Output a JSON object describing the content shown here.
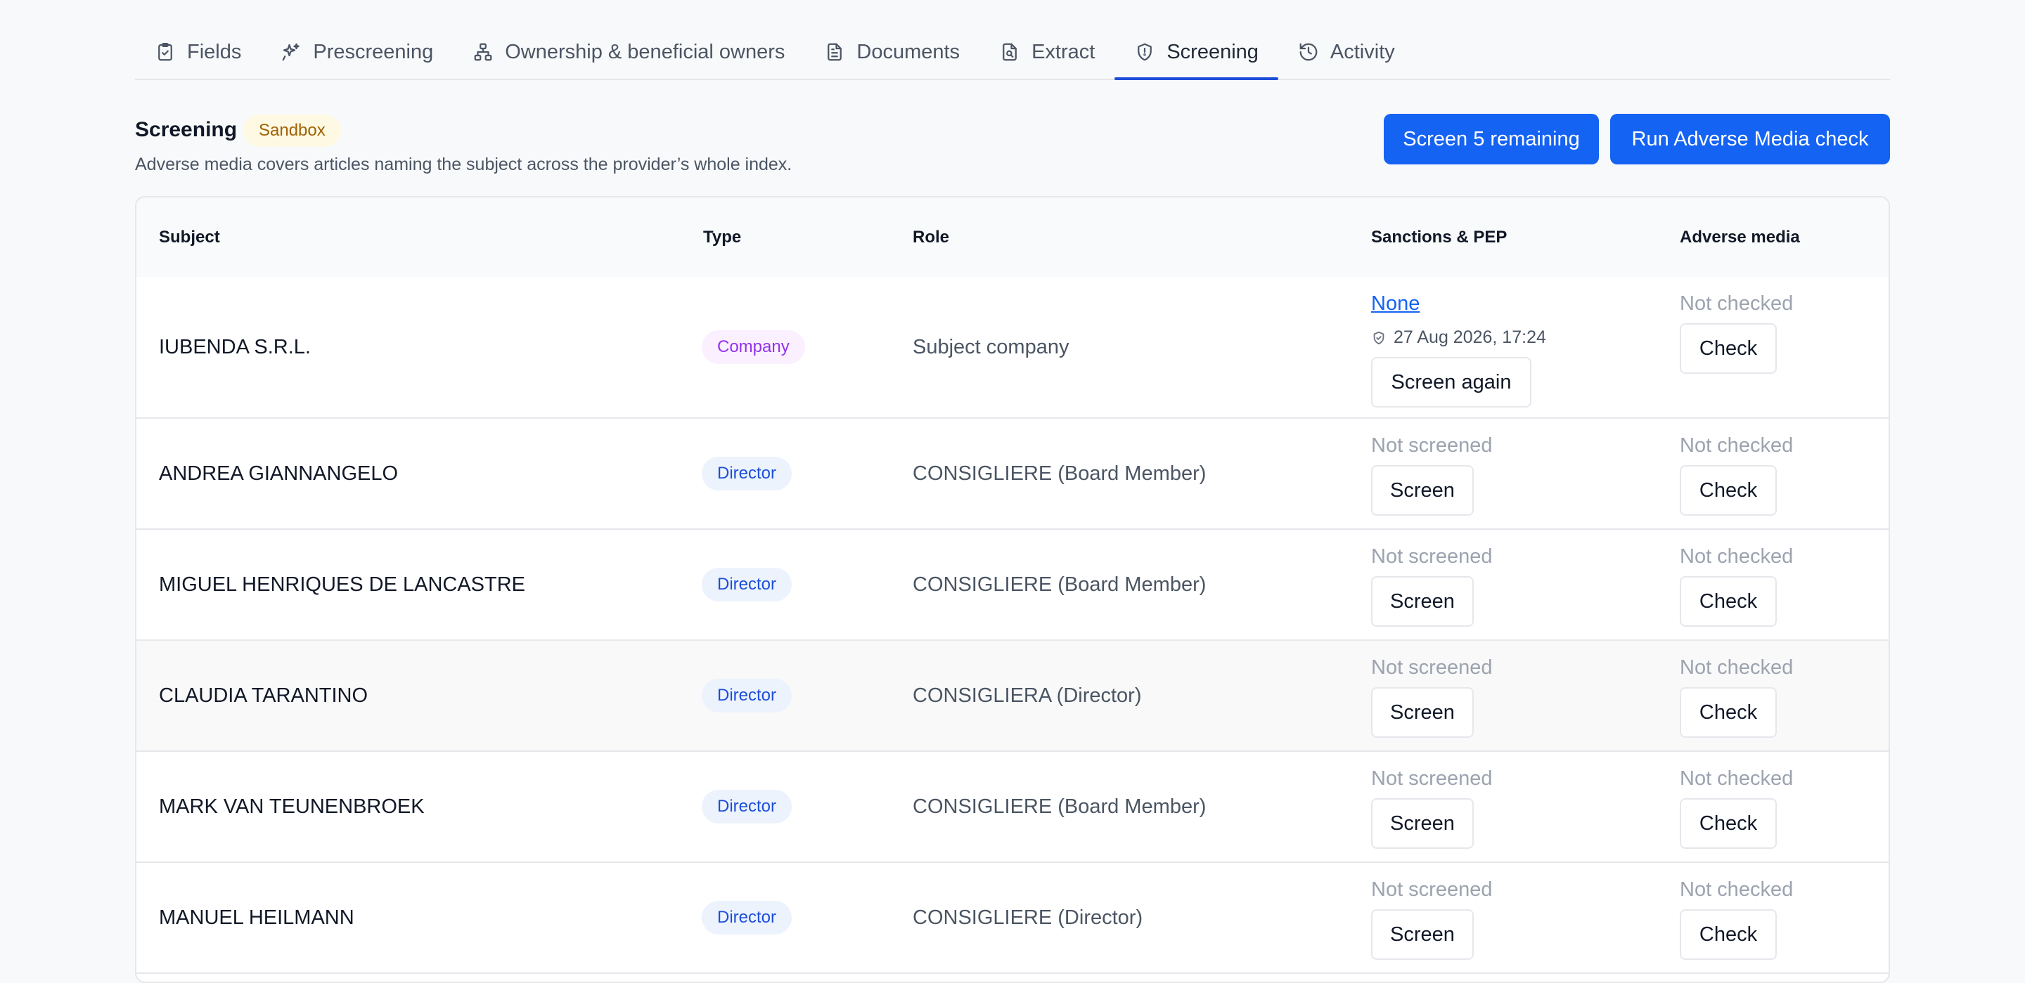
{
  "tabs": [
    {
      "label": "Fields",
      "icon": "clipboard-check-icon"
    },
    {
      "label": "Prescreening",
      "icon": "sparkles-icon"
    },
    {
      "label": "Ownership & beneficial owners",
      "icon": "network-icon"
    },
    {
      "label": "Documents",
      "icon": "document-icon"
    },
    {
      "label": "Extract",
      "icon": "file-search-icon"
    },
    {
      "label": "Screening",
      "icon": "shield-icon"
    },
    {
      "label": "Activity",
      "icon": "history-icon"
    }
  ],
  "active_tab": "Screening",
  "section": {
    "title": "Screening",
    "badge": "Sandbox",
    "description": "Adverse media covers articles naming the subject across the provider’s whole index.",
    "screen_remaining_label": "Screen 5 remaining",
    "adverse_check_label": "Run Adverse Media check"
  },
  "table": {
    "headers": {
      "subject": "Subject",
      "type": "Type",
      "role": "Role",
      "sanctions": "Sanctions & PEP",
      "adverse": "Adverse media"
    },
    "rows": [
      {
        "subject": "IUBENDA S.R.L.",
        "type": "Company",
        "role": "Subject company",
        "sanctions_status": "None",
        "sanctions_timestamp": "27 Aug 2026, 17:24",
        "sanctions_button": "Screen again",
        "adverse_status": "Not checked",
        "adverse_button": "Check"
      },
      {
        "subject": "ANDREA GIANNANGELO",
        "type": "Director",
        "role": "CONSIGLIERE (Board Member)",
        "sanctions_status": "Not screened",
        "sanctions_button": "Screen",
        "adverse_status": "Not checked",
        "adverse_button": "Check"
      },
      {
        "subject": "MIGUEL HENRIQUES DE LANCASTRE",
        "type": "Director",
        "role": "CONSIGLIERE (Board Member)",
        "sanctions_status": "Not screened",
        "sanctions_button": "Screen",
        "adverse_status": "Not checked",
        "adverse_button": "Check"
      },
      {
        "subject": "CLAUDIA TARANTINO",
        "type": "Director",
        "role": "CONSIGLIERA (Director)",
        "sanctions_status": "Not screened",
        "sanctions_button": "Screen",
        "adverse_status": "Not checked",
        "adverse_button": "Check"
      },
      {
        "subject": "MARK VAN TEUNENBROEK",
        "type": "Director",
        "role": "CONSIGLIERE (Board Member)",
        "sanctions_status": "Not screened",
        "sanctions_button": "Screen",
        "adverse_status": "Not checked",
        "adverse_button": "Check"
      },
      {
        "subject": "MANUEL HEILMANN",
        "type": "Director",
        "role": "CONSIGLIERE (Director)",
        "sanctions_status": "Not screened",
        "sanctions_button": "Screen",
        "adverse_status": "Not checked",
        "adverse_button": "Check"
      }
    ]
  },
  "colors": {
    "primary": "#1463f3",
    "company_pill": "#9333ea",
    "director_pill": "#1d4ed8",
    "sandbox_badge": "#a16207"
  }
}
